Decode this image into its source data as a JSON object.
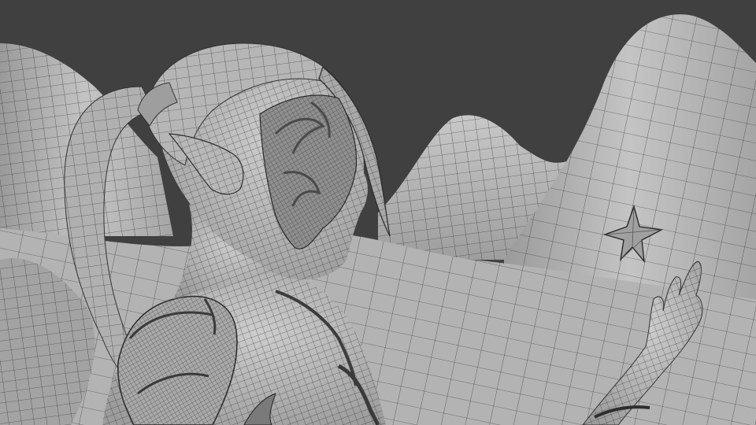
{
  "viewport": {
    "background_color": "#404040",
    "mesh_color": "#b9b9b9",
    "mesh_shadow_color": "#8d8d8d",
    "wire_color": "#1e1e1e",
    "face_patch_color": "#9a9a9a",
    "ornament_color": "#6f6f6f"
  },
  "scene": {
    "subject": "wireframe-sculpt",
    "elements": [
      "mountain-range",
      "elf-figure-head",
      "ponytail",
      "ear",
      "face-ornament",
      "neck",
      "shoulder-armor",
      "raised-hand",
      "star-gem"
    ]
  }
}
